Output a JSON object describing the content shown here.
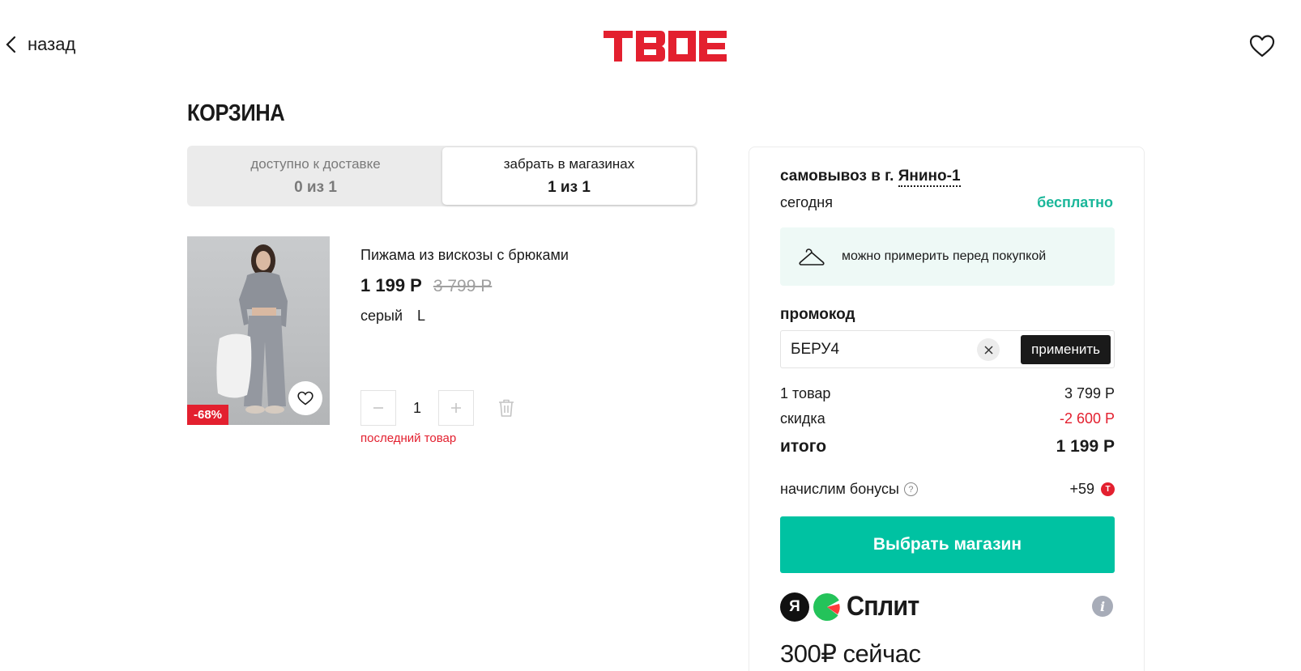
{
  "header": {
    "back_label": "назад",
    "logo_text": "ТВОЕ",
    "brand_color": "#e3202f"
  },
  "page": {
    "title": "КОРЗИНА"
  },
  "tabs": [
    {
      "label": "доступно к доставке",
      "count": "0 из 1",
      "active": false
    },
    {
      "label": "забрать в магазинах",
      "count": "1 из 1",
      "active": true
    }
  ],
  "product": {
    "name": "Пижама из вискозы с брюками",
    "price": "1 199 Р",
    "old_price": "3 799 Р",
    "color": "серый",
    "size": "L",
    "discount_badge": "-68%",
    "quantity": "1",
    "stock_note": "последний товар"
  },
  "summary": {
    "pickup_prefix": "самовывоз в г.",
    "pickup_city": "Янино-1",
    "pickup_day": "сегодня",
    "pickup_price": "бесплатно",
    "tryon_text": "можно примерить перед покупкой",
    "promo_label": "промокод",
    "promo_value": "БЕРУ4",
    "promo_apply": "применить",
    "items_label": "1 товар",
    "items_value": "3 799 Р",
    "discount_label": "скидка",
    "discount_value": "-2 600 Р",
    "total_label": "итого",
    "total_value": "1 199 Р",
    "bonus_label": "начислим бонусы",
    "bonus_value": "+59",
    "cta": "Выбрать магазин",
    "accent_color": "#00c2a2"
  },
  "split": {
    "ya_letter": "Я",
    "title": "Сплит",
    "now_text": "300₽ сейчас"
  }
}
